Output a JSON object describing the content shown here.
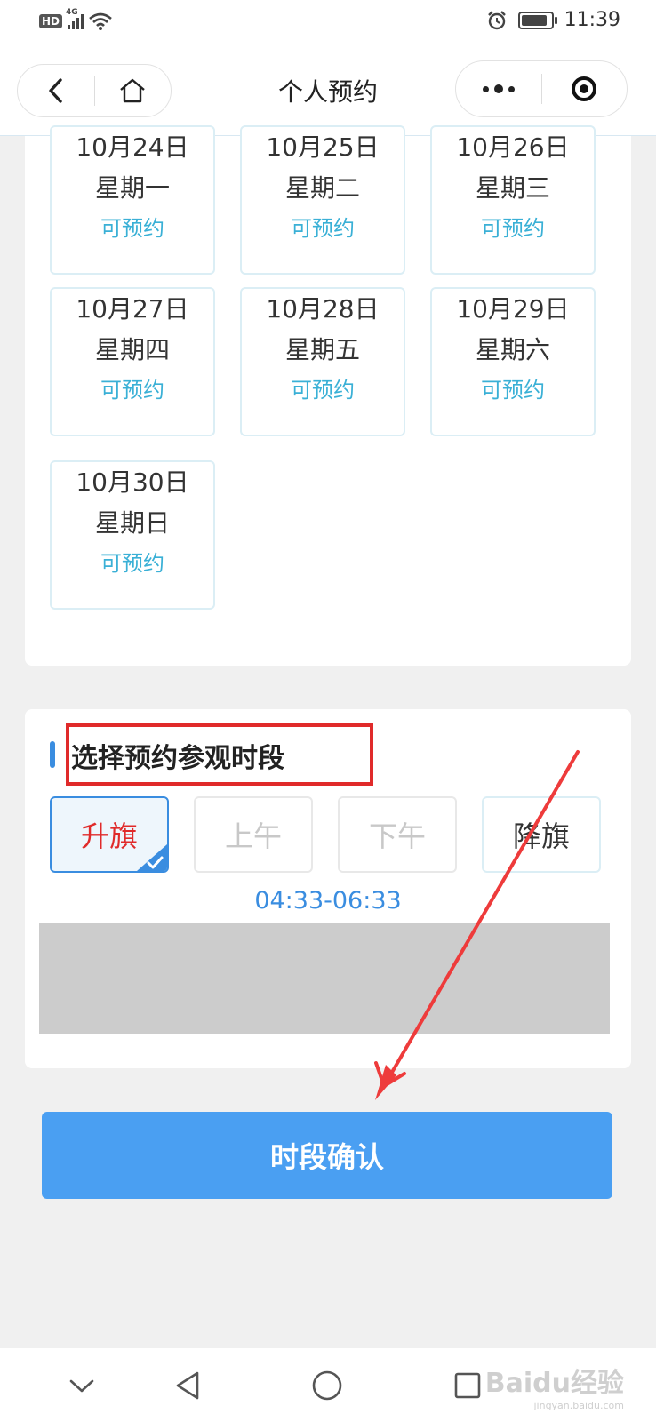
{
  "status_bar": {
    "left_badge": "HD",
    "network": "4G",
    "time": "11:39"
  },
  "nav": {
    "title": "个人预约"
  },
  "dates": [
    {
      "date": "10月24日",
      "weekday": "星期一",
      "status": "可预约"
    },
    {
      "date": "10月25日",
      "weekday": "星期二",
      "status": "可预约"
    },
    {
      "date": "10月26日",
      "weekday": "星期三",
      "status": "可预约"
    },
    {
      "date": "10月27日",
      "weekday": "星期四",
      "status": "可预约"
    },
    {
      "date": "10月28日",
      "weekday": "星期五",
      "status": "可预约"
    },
    {
      "date": "10月29日",
      "weekday": "星期六",
      "status": "可预约"
    },
    {
      "date": "10月30日",
      "weekday": "星期日",
      "status": "可预约"
    }
  ],
  "time_section": {
    "title": "选择预约参观时段",
    "slots": [
      {
        "label": "升旗",
        "state": "selected"
      },
      {
        "label": "上午",
        "state": "disabled"
      },
      {
        "label": "下午",
        "state": "disabled"
      },
      {
        "label": "降旗",
        "state": "available"
      }
    ],
    "time_range": "04:33-06:33"
  },
  "confirm_button": "时段确认",
  "watermark": {
    "brand": "Baidu经验",
    "url": "jingyan.baidu.com"
  },
  "colors": {
    "accent_blue": "#4a9ff2",
    "status_teal": "#3ab0d6",
    "annotation_red": "#e02a2a"
  }
}
